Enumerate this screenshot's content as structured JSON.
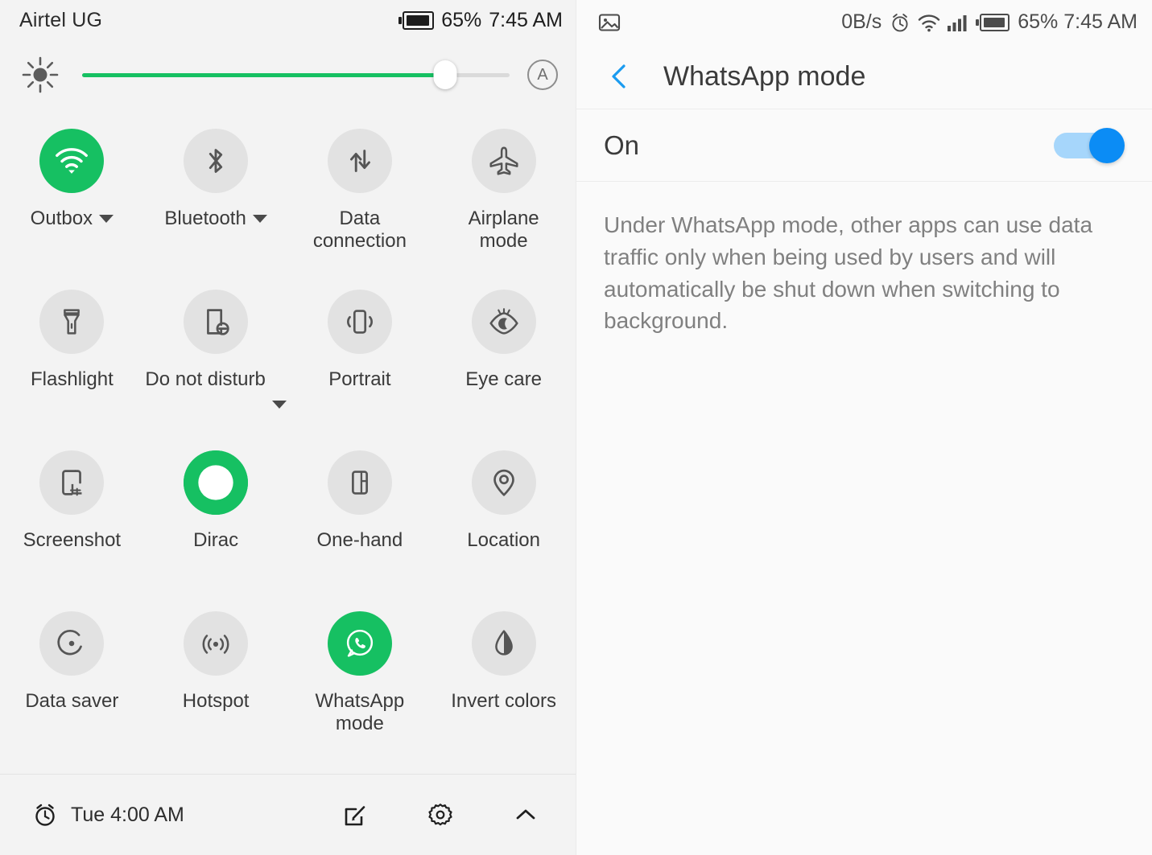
{
  "left_panel": {
    "statusbar": {
      "carrier": "Airtel UG",
      "battery_percent": "65%",
      "time": "7:45 AM",
      "battery_icon": "battery-icon"
    },
    "brightness": {
      "icon": "brightness-sun-icon",
      "value_percent": 85,
      "auto_label": "A",
      "accent_color": "#16c062"
    },
    "tiles": [
      {
        "label": "Outbox",
        "icon": "wifi-icon",
        "active": true,
        "has_caret": true,
        "caret_lowered": false
      },
      {
        "label": "Bluetooth",
        "icon": "bluetooth-icon",
        "active": false,
        "has_caret": true,
        "caret_lowered": false
      },
      {
        "label": "Data connection",
        "icon": "data-connection-icon",
        "active": false,
        "has_caret": false,
        "caret_lowered": false
      },
      {
        "label": "Airplane mode",
        "icon": "airplane-icon",
        "active": false,
        "has_caret": false,
        "caret_lowered": false
      },
      {
        "label": "Flashlight",
        "icon": "flashlight-icon",
        "active": false,
        "has_caret": false,
        "caret_lowered": false
      },
      {
        "label": "Do not disturb",
        "icon": "do-not-disturb-icon",
        "active": false,
        "has_caret": true,
        "caret_lowered": true
      },
      {
        "label": "Portrait",
        "icon": "rotation-portrait-icon",
        "active": false,
        "has_caret": false,
        "caret_lowered": false
      },
      {
        "label": "Eye care",
        "icon": "eye-care-icon",
        "active": false,
        "has_caret": false,
        "caret_lowered": false
      },
      {
        "label": "Screenshot",
        "icon": "screenshot-icon",
        "active": false,
        "has_caret": false,
        "caret_lowered": false
      },
      {
        "label": "Dirac",
        "icon": "dirac-ring-icon",
        "active": true,
        "has_caret": false,
        "caret_lowered": false
      },
      {
        "label": "One-hand",
        "icon": "one-hand-icon",
        "active": false,
        "has_caret": false,
        "caret_lowered": false
      },
      {
        "label": "Location",
        "icon": "location-pin-icon",
        "active": false,
        "has_caret": false,
        "caret_lowered": false
      },
      {
        "label": "Data saver",
        "icon": "data-saver-icon",
        "active": false,
        "has_caret": false,
        "caret_lowered": false
      },
      {
        "label": "Hotspot",
        "icon": "hotspot-icon",
        "active": false,
        "has_caret": false,
        "caret_lowered": false
      },
      {
        "label": "WhatsApp mode",
        "icon": "whatsapp-icon",
        "active": true,
        "has_caret": false,
        "caret_lowered": false
      },
      {
        "label": "Invert colors",
        "icon": "invert-colors-icon",
        "active": false,
        "has_caret": false,
        "caret_lowered": false
      }
    ],
    "footer": {
      "alarm_icon": "alarm-clock-icon",
      "alarm_text": "Tue 4:00 AM",
      "edit_icon": "edit-icon",
      "settings_icon": "gear-icon",
      "collapse_icon": "chevron-up-icon"
    }
  },
  "right_panel": {
    "statusbar": {
      "left_icon": "image-icon",
      "data_rate": "0B/s",
      "alarm_icon": "alarm-clock-icon",
      "wifi_icon": "wifi-icon",
      "signal_icon": "signal-bars-icon",
      "battery_icon": "battery-icon",
      "battery_percent": "65%",
      "time": "7:45 AM"
    },
    "appbar": {
      "back_icon": "chevron-left-icon",
      "title": "WhatsApp mode",
      "accent_color": "#1a9bf0"
    },
    "toggle": {
      "label": "On",
      "state": "on",
      "track_color": "#a6d6fb",
      "thumb_color": "#0b8cf5"
    },
    "description": "Under WhatsApp mode, other apps can use data traffic only when being used by users and will automatically be shut down when switching to background."
  }
}
